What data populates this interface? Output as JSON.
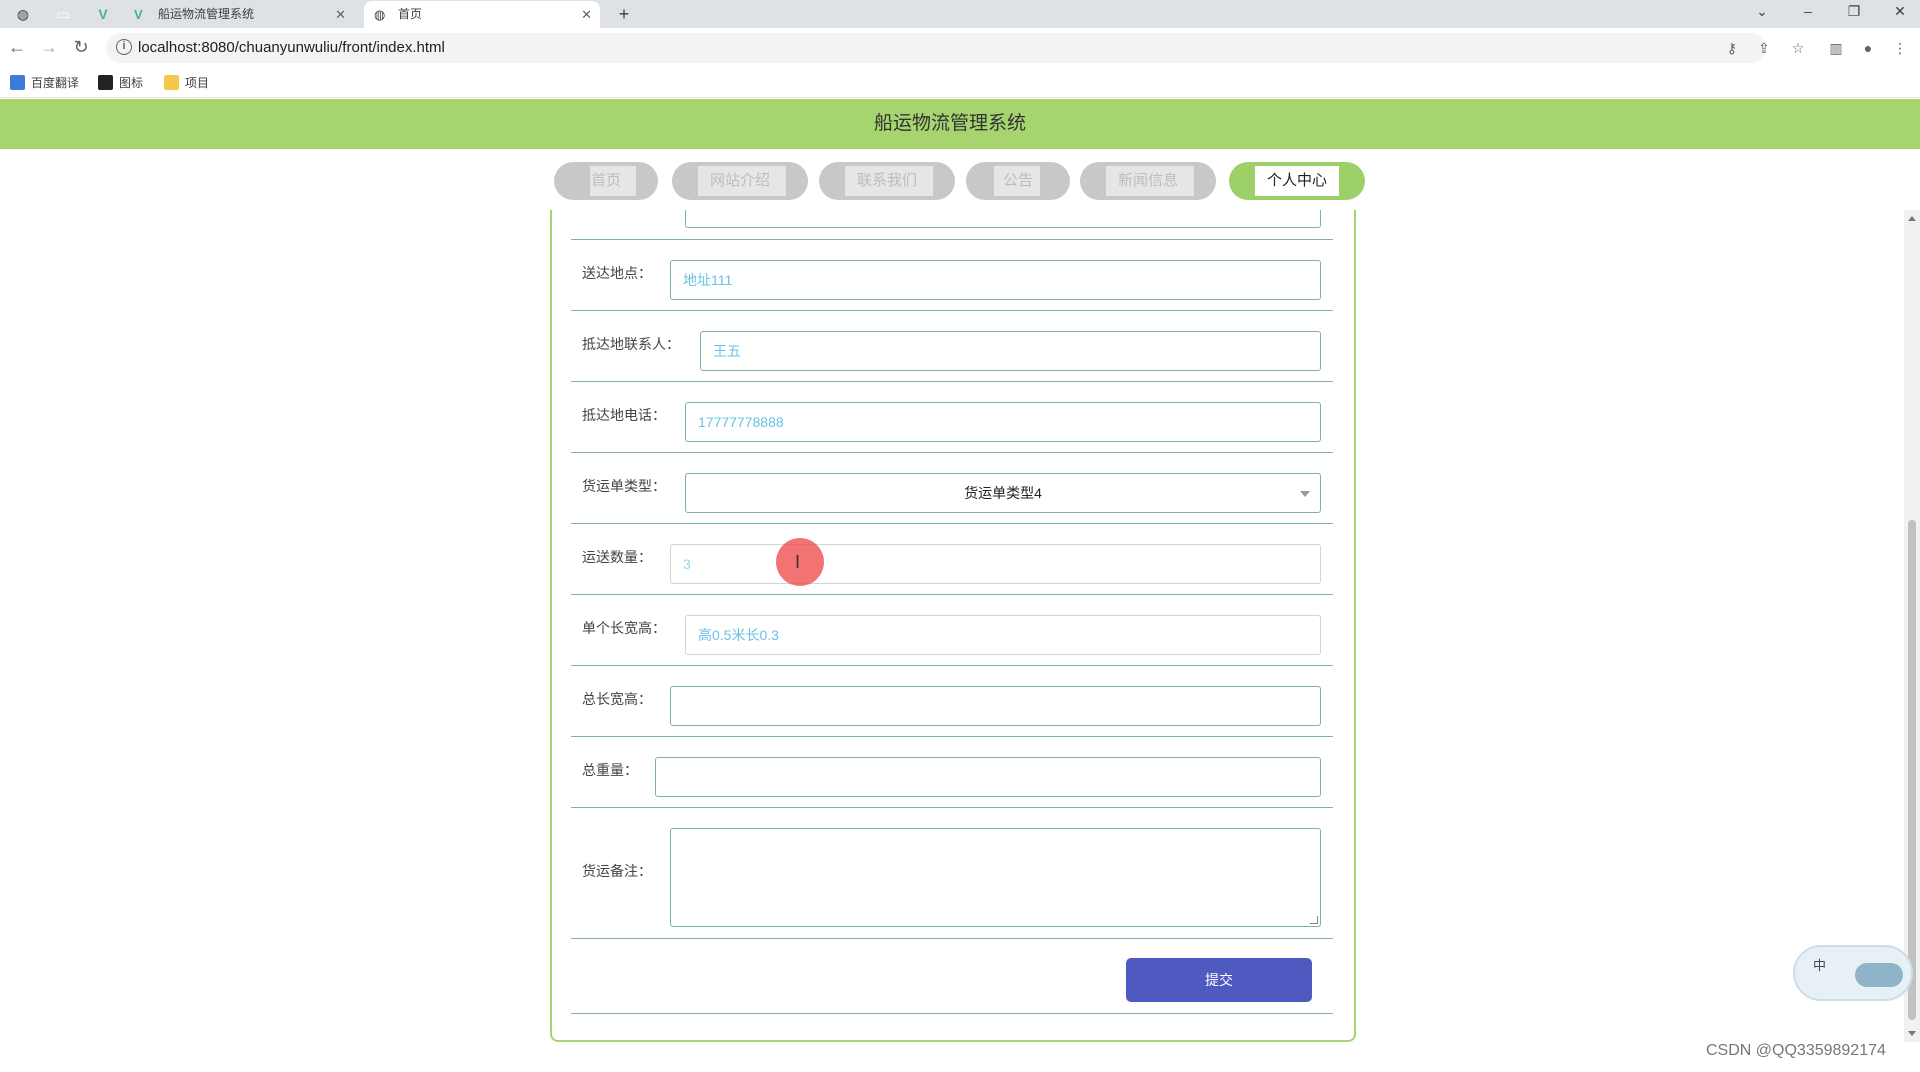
{
  "browser": {
    "tabs": [
      {
        "title": "船运物流管理系统",
        "active": false
      },
      {
        "title": "首页",
        "active": true
      }
    ],
    "new_tab": "+",
    "url": "localhost:8080/chuanyunwuliu/front/index.html",
    "bookmarks": [
      "百度翻译",
      "图标",
      "项目"
    ]
  },
  "site": {
    "title": "船运物流管理系统",
    "nav": [
      {
        "label": "首页",
        "active": false
      },
      {
        "label": "网站介绍",
        "active": false
      },
      {
        "label": "联系我们",
        "active": false
      },
      {
        "label": "公告",
        "active": false
      },
      {
        "label": "新闻信息",
        "active": false
      },
      {
        "label": "个人中心",
        "active": true
      }
    ]
  },
  "form": {
    "fields": [
      {
        "label": "送达地点：",
        "value": "地址111"
      },
      {
        "label": "抵达地联系人：",
        "value": "王五"
      },
      {
        "label": "抵达地电话：",
        "value": "17777778888"
      },
      {
        "label": "货运单类型：",
        "value": "货运单类型4"
      },
      {
        "label": "运送数量：",
        "value": "3"
      },
      {
        "label": "单个长宽高：",
        "value": "高0.5米长0.3"
      },
      {
        "label": "总长宽高：",
        "value": ""
      },
      {
        "label": "总重量：",
        "value": ""
      },
      {
        "label": "货运备注：",
        "value": ""
      }
    ],
    "submit_label": "提交"
  },
  "ime": {
    "char": "中"
  },
  "watermark": "CSDN @QQ3359892174",
  "colors": {
    "header_green": "#a6d46e",
    "submit_blue": "#4f5ac0",
    "input_text": "#6cc0e8"
  }
}
